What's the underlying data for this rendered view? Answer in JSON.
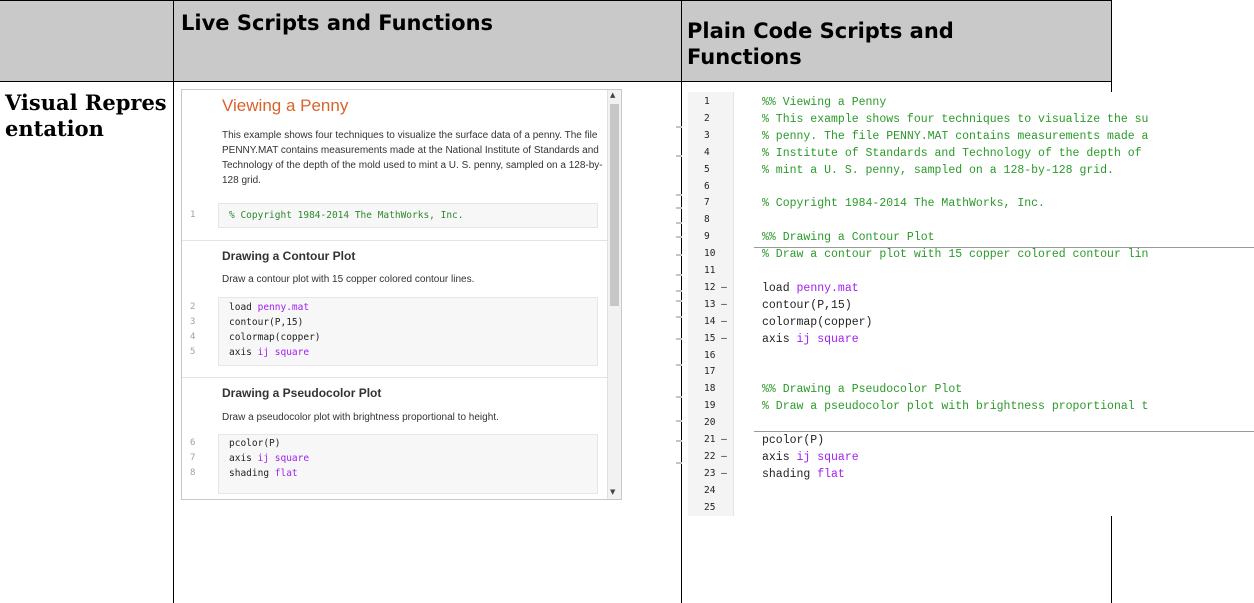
{
  "table": {
    "col_live": "Live Scripts and Functions",
    "col_plain": "Plain Code Scripts and Functions",
    "row_visual": "Visual Representation"
  },
  "live": {
    "title": "Viewing a Penny",
    "intro": "This example shows four techniques to visualize the surface data of a penny. The file PENNY.MAT contains measurements made at the National Institute of Standards and Technology of the depth of the mold used to mint a U. S. penny, sampled on a 128-by-128 grid.",
    "ln1": "1",
    "code1": "% Copyright 1984-2014 The MathWorks, Inc.",
    "sec2_title": "Drawing a Contour Plot",
    "sec2_text": "Draw a contour plot with 15 copper colored contour lines.",
    "code2": [
      {
        "ln": "2",
        "pre": "load ",
        "kw": "penny.mat"
      },
      {
        "ln": "3",
        "pre": "contour(P,15)",
        "kw": ""
      },
      {
        "ln": "4",
        "pre": "colormap(copper)",
        "kw": ""
      },
      {
        "ln": "5",
        "pre": "axis ",
        "kw": "ij square"
      }
    ],
    "sec3_title": "Drawing a Pseudocolor Plot",
    "sec3_text": "Draw a pseudocolor plot with brightness proportional to height.",
    "code3": [
      {
        "ln": "6",
        "pre": "pcolor(P)",
        "kw": ""
      },
      {
        "ln": "7",
        "pre": "axis ",
        "kw": "ij square"
      },
      {
        "ln": "8",
        "pre": "shading ",
        "kw": "flat"
      }
    ]
  },
  "plain": {
    "lines": [
      {
        "n": "1",
        "text": "%% Viewing a Penny",
        "type": "cmt"
      },
      {
        "n": "2",
        "text": "% This example shows four techniques to visualize the su",
        "type": "cmt"
      },
      {
        "n": "3",
        "text": "% penny. The file PENNY.MAT contains measurements made a",
        "type": "cmt"
      },
      {
        "n": "4",
        "text": "% Institute of Standards and Technology of the depth of",
        "type": "cmt"
      },
      {
        "n": "5",
        "text": "% mint a U. S. penny, sampled on a 128-by-128 grid.",
        "type": "cmt"
      },
      {
        "n": "6",
        "text": "",
        "type": "code"
      },
      {
        "n": "7",
        "text": "% Copyright 1984-2014 The MathWorks, Inc.",
        "type": "cmt"
      },
      {
        "n": "8",
        "text": "",
        "type": "code"
      },
      {
        "n": "9",
        "text": "%% Drawing a Contour Plot",
        "type": "cmt"
      },
      {
        "n": "10",
        "text": "% Draw a contour plot with 15 copper colored contour lin",
        "type": "cmt"
      },
      {
        "n": "11",
        "text": "",
        "type": "code"
      },
      {
        "n": "12 –",
        "text": "load ",
        "kw": "penny.mat",
        "type": "code"
      },
      {
        "n": "13 –",
        "text": "contour(P,15)",
        "type": "code"
      },
      {
        "n": "14 –",
        "text": "colormap(copper)",
        "type": "code"
      },
      {
        "n": "15 –",
        "text": "axis ",
        "kw": "ij square",
        "type": "code"
      },
      {
        "n": "16",
        "text": "",
        "type": "code"
      },
      {
        "n": "17",
        "text": "",
        "type": "code"
      },
      {
        "n": "18",
        "text": "%% Drawing a Pseudocolor Plot",
        "type": "cmt"
      },
      {
        "n": "19",
        "text": "% Draw a pseudocolor plot with brightness proportional t",
        "type": "cmt"
      },
      {
        "n": "20",
        "text": "",
        "type": "code"
      },
      {
        "n": "21 –",
        "text": "pcolor(P)",
        "type": "code"
      },
      {
        "n": "22 –",
        "text": "axis ",
        "kw": "ij square",
        "type": "code"
      },
      {
        "n": "23 –",
        "text": "shading ",
        "kw": "flat",
        "type": "code"
      },
      {
        "n": "24",
        "text": "",
        "type": "code"
      },
      {
        "n": "25",
        "text": "",
        "type": "code"
      }
    ]
  },
  "colors": {
    "header_bg": "#c9c9c9",
    "comment": "#2a9a2a",
    "keyword": "#a020f0",
    "title": "#d9632b"
  }
}
